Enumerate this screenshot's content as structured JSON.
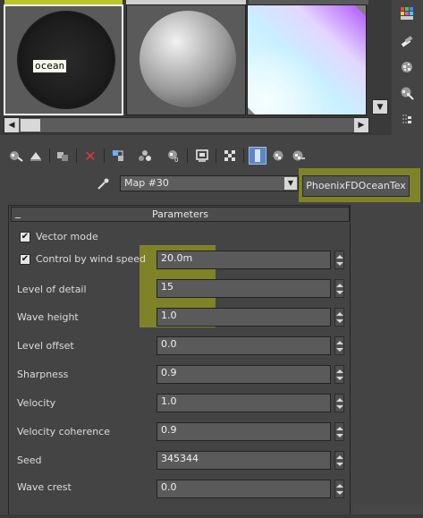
{
  "window": {},
  "sample_slots": [
    {
      "name": "ocean-sample-slot",
      "label": "ocean",
      "selected": true
    },
    {
      "name": "standard-material-sample-slot"
    },
    {
      "name": "gradient-sample-slot"
    }
  ],
  "map": {
    "name": "Map #30",
    "type_button": "PhoenixFDOceanTex"
  },
  "rollout": {
    "title": "Parameters",
    "collapse": "_",
    "vector_mode": {
      "label": "Vector mode",
      "checked": true
    },
    "control_by_wind_speed": {
      "label": "Control by wind speed",
      "checked": true,
      "value": "20.0m"
    },
    "level_of_detail": {
      "label": "Level of detail",
      "value": "15"
    },
    "wave_height": {
      "label": "Wave height",
      "value": "1.0"
    },
    "level_offset": {
      "label": "Level offset",
      "value": "0.0"
    },
    "sharpness": {
      "label": "Sharpness",
      "value": "0.9"
    },
    "velocity": {
      "label": "Velocity",
      "value": "1.0"
    },
    "velocity_coherence": {
      "label": "Velocity coherence",
      "value": "0.9"
    },
    "seed": {
      "label": "Seed",
      "value": "345344"
    },
    "wave_crest": {
      "label": "Wave crest",
      "value": "0.0"
    }
  },
  "colors": {
    "panel_bg": "#444444",
    "field_bg": "#5a5a5a",
    "highlight": "#d2dc00",
    "active_tool": "#5b86c7"
  },
  "icons": {
    "toolbar": [
      "get-material-icon",
      "put-material-icon",
      "assign-material-icon",
      "delete-icon",
      "make-unique-icon",
      "put-to-library-icon",
      "material-id-icon",
      "show-map-icon",
      "show-background-icon",
      "show-end-result-icon",
      "go-to-parent-icon",
      "go-forward-icon",
      "options-icon"
    ],
    "side": [
      "sample-type-icon",
      "backlight-icon",
      "background-icon",
      "uv-tiling-icon",
      "video-check-icon",
      "make-preview-icon"
    ]
  }
}
